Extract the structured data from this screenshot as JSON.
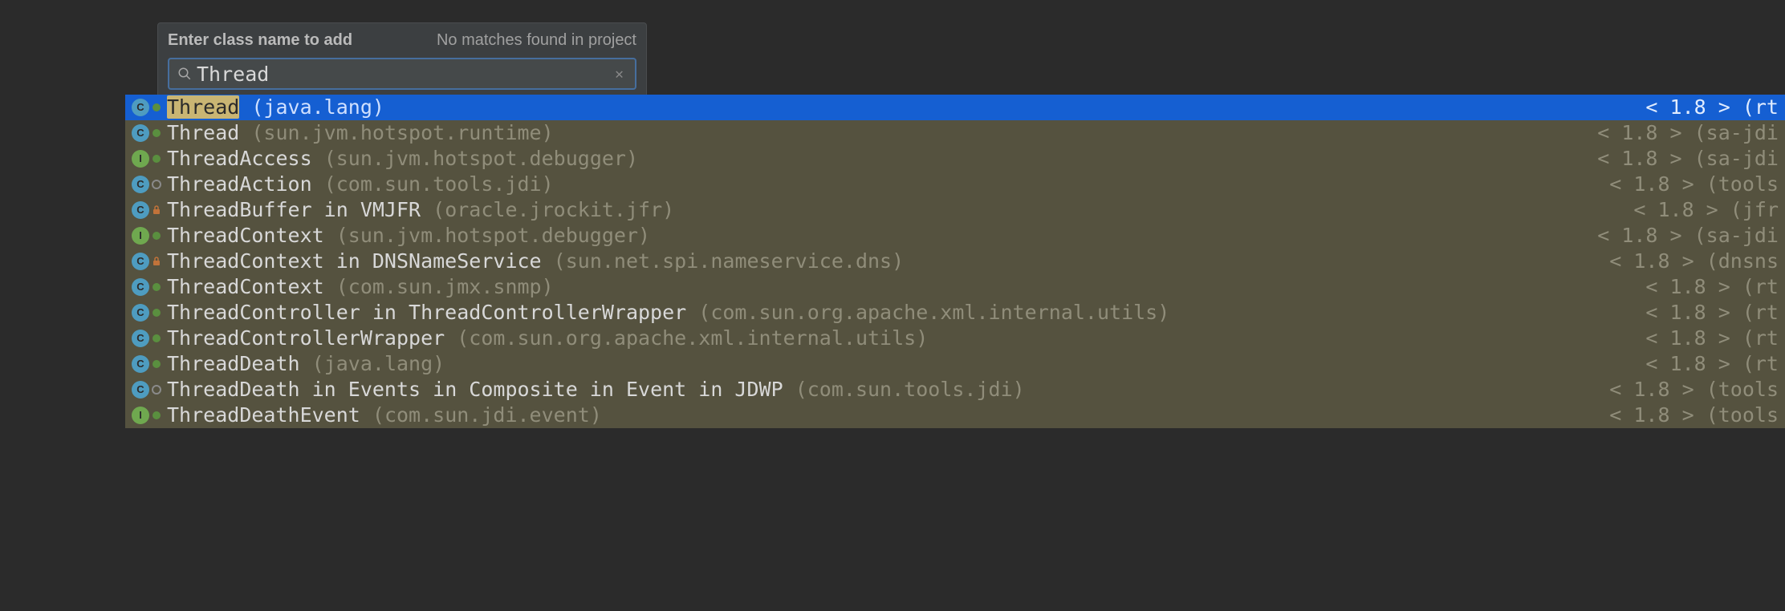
{
  "search": {
    "label": "Enter class name to add",
    "status": "No matches found in project",
    "value": "Thread"
  },
  "results": [
    {
      "selected": true,
      "kind": "class",
      "mod": "pub",
      "match": "Thread",
      "rest": "",
      "in": "",
      "pkg": "(java.lang)",
      "meta": "< 1.8 > (rt"
    },
    {
      "selected": false,
      "kind": "class",
      "mod": "pub",
      "match": "Thread",
      "rest": "",
      "in": "",
      "pkg": "(sun.jvm.hotspot.runtime)",
      "meta": "< 1.8 > (sa-jdi"
    },
    {
      "selected": false,
      "kind": "interface",
      "mod": "pub",
      "match": "Thread",
      "rest": "Access",
      "in": "",
      "pkg": "(sun.jvm.hotspot.debugger)",
      "meta": "< 1.8 > (sa-jdi"
    },
    {
      "selected": false,
      "kind": "class",
      "mod": "pkg",
      "match": "Thread",
      "rest": "Action",
      "in": "",
      "pkg": "(com.sun.tools.jdi)",
      "meta": "< 1.8 > (tools"
    },
    {
      "selected": false,
      "kind": "class",
      "mod": "priv",
      "match": "Thread",
      "rest": "Buffer",
      "in": " in VMJFR",
      "pkg": "(oracle.jrockit.jfr)",
      "meta": "< 1.8 > (jfr"
    },
    {
      "selected": false,
      "kind": "interface",
      "mod": "pub",
      "match": "Thread",
      "rest": "Context",
      "in": "",
      "pkg": "(sun.jvm.hotspot.debugger)",
      "meta": "< 1.8 > (sa-jdi"
    },
    {
      "selected": false,
      "kind": "class",
      "mod": "priv",
      "match": "Thread",
      "rest": "Context",
      "in": " in DNSNameService",
      "pkg": "(sun.net.spi.nameservice.dns)",
      "meta": "< 1.8 > (dnsns"
    },
    {
      "selected": false,
      "kind": "class",
      "mod": "pub",
      "match": "Thread",
      "rest": "Context",
      "in": "",
      "pkg": "(com.sun.jmx.snmp)",
      "meta": "< 1.8 > (rt"
    },
    {
      "selected": false,
      "kind": "class",
      "mod": "pub",
      "match": "Thread",
      "rest": "Controller",
      "in": " in ThreadControllerWrapper",
      "pkg": "(com.sun.org.apache.xml.internal.utils)",
      "meta": "< 1.8 > (rt"
    },
    {
      "selected": false,
      "kind": "class",
      "mod": "pub",
      "match": "Thread",
      "rest": "ControllerWrapper",
      "in": "",
      "pkg": "(com.sun.org.apache.xml.internal.utils)",
      "meta": "< 1.8 > (rt"
    },
    {
      "selected": false,
      "kind": "class",
      "mod": "pub",
      "match": "Thread",
      "rest": "Death",
      "in": "",
      "pkg": "(java.lang)",
      "meta": "< 1.8 > (rt"
    },
    {
      "selected": false,
      "kind": "class",
      "mod": "pkg",
      "match": "Thread",
      "rest": "Death",
      "in": " in Events in Composite in Event in JDWP",
      "pkg": "(com.sun.tools.jdi)",
      "meta": "< 1.8 > (tools"
    },
    {
      "selected": false,
      "kind": "interface",
      "mod": "pub",
      "match": "Thread",
      "rest": "DeathEvent",
      "in": "",
      "pkg": "(com.sun.jdi.event)",
      "meta": "< 1.8 > (tools"
    }
  ]
}
